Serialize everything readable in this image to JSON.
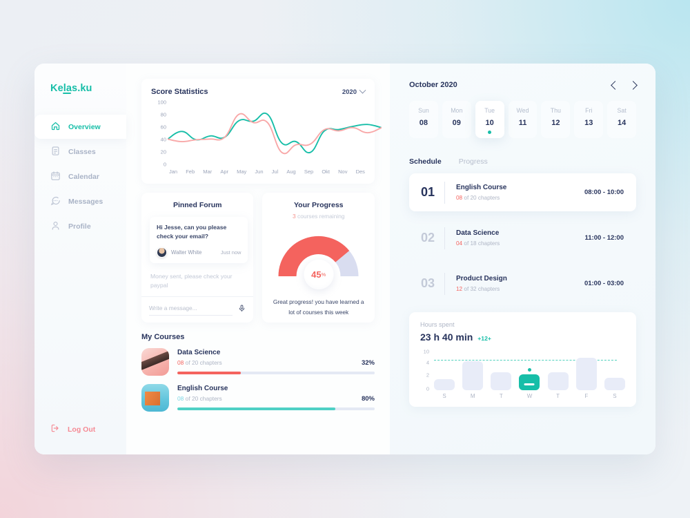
{
  "brand": {
    "name": "Kelas.ku"
  },
  "sidebar": {
    "items": [
      {
        "label": "Overview",
        "icon": "home-icon",
        "active": true
      },
      {
        "label": "Classes",
        "icon": "document-icon",
        "active": false
      },
      {
        "label": "Calendar",
        "icon": "calendar-icon",
        "active": false
      },
      {
        "label": "Messages",
        "icon": "chat-icon",
        "active": false
      },
      {
        "label": "Profile",
        "icon": "person-icon",
        "active": false
      }
    ],
    "logout": {
      "label": "Log Out",
      "icon": "logout-icon"
    }
  },
  "score_card": {
    "title": "Score Statistics",
    "year": "2020"
  },
  "forum": {
    "title": "Pinned Forum",
    "message": "Hi Jesse, can you please check your email?",
    "author": "Walter White",
    "time": "Just now",
    "ghost_message": "Money sent, please check your paypal",
    "input_placeholder": "Write a message...",
    "mic_icon": "microphone-icon"
  },
  "progress": {
    "title": "Your Progress",
    "subtitle_count": "3",
    "subtitle_rest": " courses remaining",
    "value": "45",
    "unit": "%",
    "percent": 45,
    "footer": "Great progress! you have learned a lot of courses this week",
    "fill_color": "#f4635e",
    "track_color": "#d9ddf0"
  },
  "courses": {
    "title": "My Courses",
    "items": [
      {
        "name": "Data Science",
        "done": "08",
        "of": " of 20 chapters",
        "percent": "32%",
        "value": 32,
        "color": "#f4635e",
        "thumb": "data-science-thumbnail"
      },
      {
        "name": "English Course",
        "done": "08",
        "of": " of 20 chapters",
        "percent": "80%",
        "value": 80,
        "color": "#4fd0c5",
        "thumb": "english-course-thumbnail"
      }
    ]
  },
  "calendar": {
    "month": "October 2020",
    "prev_icon": "chevron-left-icon",
    "next_icon": "chevron-right-icon",
    "days": [
      {
        "name": "Sun",
        "num": "08",
        "selected": false
      },
      {
        "name": "Mon",
        "num": "09",
        "selected": false
      },
      {
        "name": "Tue",
        "num": "10",
        "selected": true
      },
      {
        "name": "Wed",
        "num": "11",
        "selected": false
      },
      {
        "name": "Thu",
        "num": "12",
        "selected": false
      },
      {
        "name": "Fri",
        "num": "13",
        "selected": false
      },
      {
        "name": "Sat",
        "num": "14",
        "selected": false
      }
    ]
  },
  "tabs": [
    {
      "label": "Schedule",
      "active": true
    },
    {
      "label": "Progress",
      "active": false
    }
  ],
  "schedule": [
    {
      "num": "01",
      "name": "English Course",
      "done": "08",
      "of": " of 20 chapters",
      "time": "08:00 - 10:00",
      "active": true
    },
    {
      "num": "02",
      "name": "Data Science",
      "done": "04",
      "of": " of 18 chapters",
      "time": "11:00 - 12:00",
      "active": false
    },
    {
      "num": "03",
      "name": "Product Design",
      "done": "12",
      "of": " of 32 chapters",
      "time": "01:00 - 03:00",
      "active": false
    }
  ],
  "hours": {
    "label": "Hours spent",
    "value": "23 h 40 min",
    "delta": "+12+"
  },
  "chart_data": [
    {
      "type": "line",
      "title": "Score Statistics",
      "xlabel": "",
      "ylabel": "",
      "ylim": [
        0,
        100
      ],
      "yticks": [
        0,
        20,
        40,
        60,
        80,
        100
      ],
      "categories": [
        "Jan",
        "Feb",
        "Mar",
        "Apr",
        "May",
        "Jun",
        "Jul",
        "Aug",
        "Sep",
        "Okt",
        "Nov",
        "Des"
      ],
      "grid": false,
      "legend": "none",
      "series": [
        {
          "name": "teal",
          "color": "#17bea8",
          "values": [
            42,
            54,
            41,
            47,
            45,
            71,
            70,
            81,
            36,
            38,
            21,
            55,
            57,
            62,
            65,
            60
          ]
        },
        {
          "name": "pink",
          "color": "#f8a8a8",
          "values": [
            42,
            38,
            41,
            42,
            45,
            81,
            68,
            68,
            21,
            33,
            34,
            57,
            55,
            60,
            52,
            60
          ]
        }
      ]
    },
    {
      "type": "bar",
      "title": "Hours spent",
      "categories": [
        "S",
        "M",
        "T",
        "W",
        "T",
        "F",
        "S"
      ],
      "values": [
        3,
        8,
        5,
        4.5,
        5,
        9,
        3.5
      ],
      "highlight_index": 3,
      "ylim": [
        0,
        10
      ],
      "yticks": [
        0,
        2,
        4,
        10
      ],
      "bar_color": "#e8ecf8",
      "highlight_color": "#17bea8",
      "grid": false
    },
    {
      "type": "pie",
      "title": "Your Progress",
      "values": [
        45,
        55
      ],
      "labels": [
        "completed",
        "remaining"
      ],
      "annotation": "45%"
    }
  ]
}
